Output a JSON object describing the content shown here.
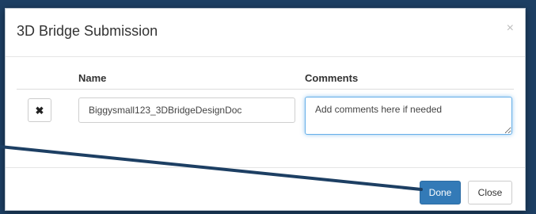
{
  "dialog": {
    "title": "3D Bridge Submission",
    "close_glyph": "×"
  },
  "table": {
    "headers": {
      "name": "Name",
      "comments": "Comments"
    },
    "row": {
      "remove_glyph": "✖",
      "name_value": "Biggysmall123_3DBridgeDesignDoc",
      "comments_placeholder": "Add comments here if needed"
    }
  },
  "footer": {
    "done_label": "Done",
    "close_label": "Close"
  },
  "colors": {
    "primary": "#337ab7",
    "annotation_arrow": "#1d3f63"
  }
}
